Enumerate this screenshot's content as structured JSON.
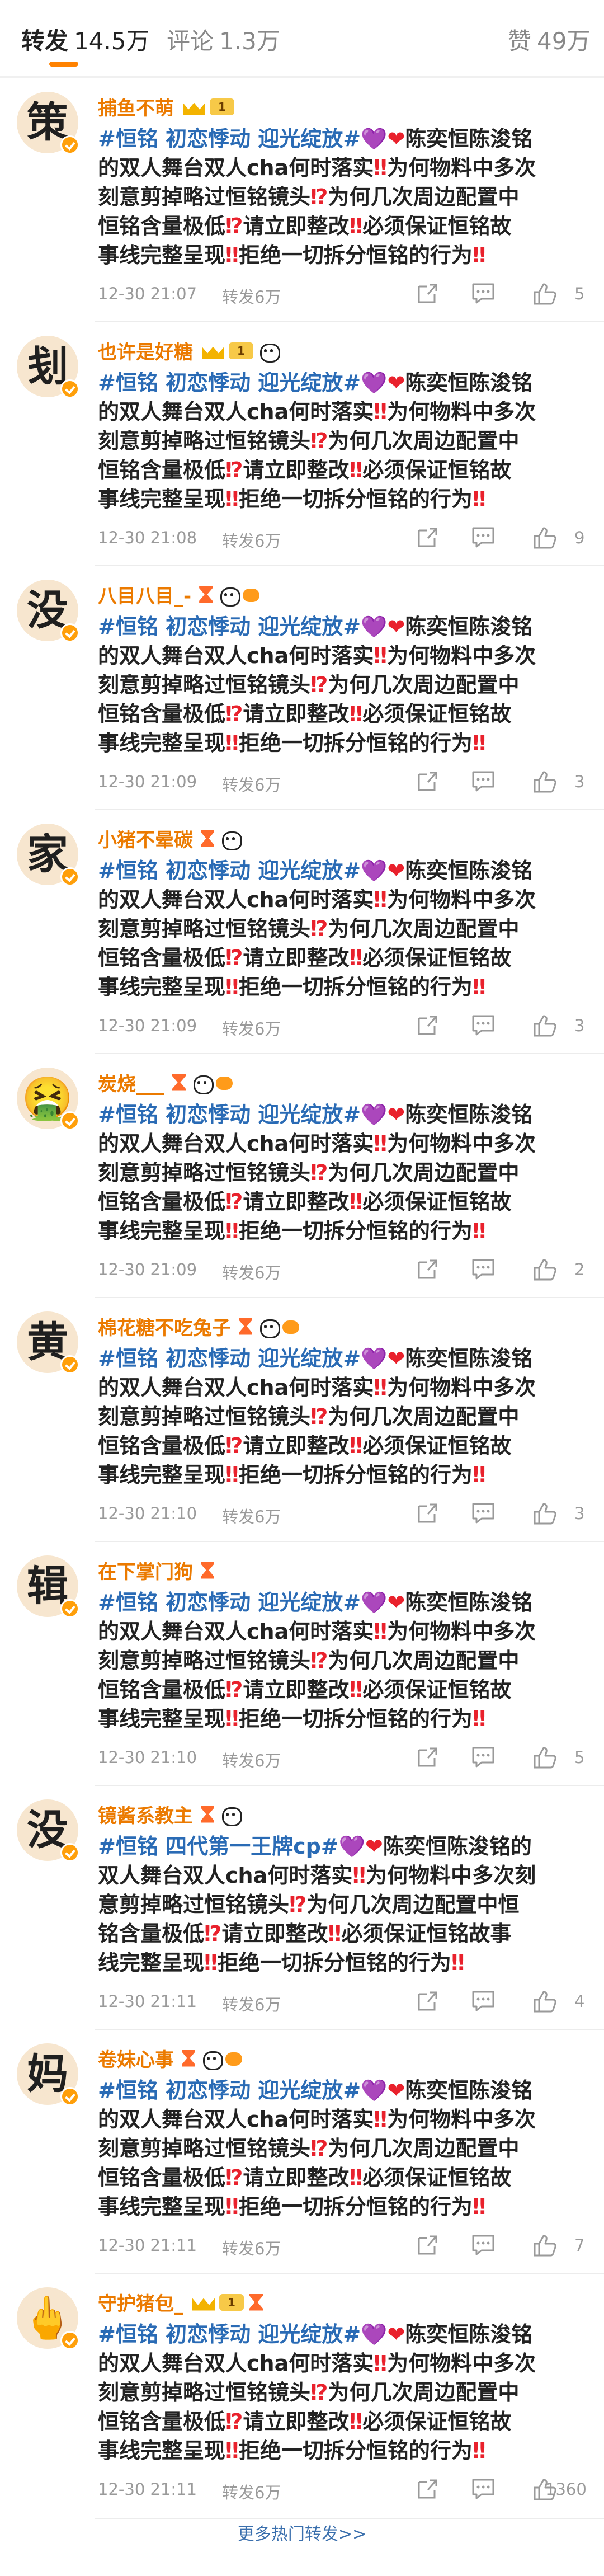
{
  "tabs": [
    {
      "label": "转发",
      "count": "14.5万",
      "active": true
    },
    {
      "label": "评论",
      "count": "1.3万",
      "active": false
    },
    {
      "label": "赞",
      "count": "49万",
      "active": false
    }
  ],
  "items": [
    {
      "name": "捕鱼不萌",
      "avatar_char": "策",
      "badges": [
        "crown",
        "level-1"
      ],
      "level": "1",
      "lines": [
        [
          {
            "t": "#恒铭 初恋悸动 迎光绽放#",
            "c": "topic"
          },
          {
            "t": "💜",
            "c": "purple"
          },
          {
            "t": "❤",
            "c": "hl"
          },
          {
            "t": "陈奕恒陈浚铭",
            "c": ""
          }
        ],
        [
          {
            "t": "的双人舞台双人cha何时落实",
            "c": ""
          },
          {
            "t": "‼",
            "c": "hl"
          },
          {
            "t": "为何物料中多次",
            "c": ""
          }
        ],
        [
          {
            "t": "刻意剪掉略过恒铭镜头",
            "c": ""
          },
          {
            "t": "⁉",
            "c": "hl"
          },
          {
            "t": "为何几次周边配置中",
            "c": ""
          }
        ],
        [
          {
            "t": "恒铭含量极低",
            "c": ""
          },
          {
            "t": "⁉",
            "c": "hl"
          },
          {
            "t": "请立即整改",
            "c": ""
          },
          {
            "t": "‼",
            "c": "hl"
          },
          {
            "t": "必须保证恒铭故",
            "c": ""
          }
        ],
        [
          {
            "t": "事线完整呈现",
            "c": ""
          },
          {
            "t": "‼",
            "c": "hl"
          },
          {
            "t": "拒绝一切拆分恒铭的行为",
            "c": ""
          },
          {
            "t": "‼",
            "c": "hl"
          }
        ]
      ],
      "time": "12-30 21:07",
      "repost": "转发6万",
      "likes": "5"
    },
    {
      "name": "也许是好糖",
      "avatar_char": "刬",
      "badges": [
        "crown",
        "level-1",
        "panda"
      ],
      "level": "1",
      "lines": [
        [
          {
            "t": "#恒铭 初恋悸动 迎光绽放#",
            "c": "topic"
          },
          {
            "t": "💜",
            "c": "purple"
          },
          {
            "t": "❤",
            "c": "hl"
          },
          {
            "t": "陈奕恒陈浚铭",
            "c": ""
          }
        ],
        [
          {
            "t": "的双人舞台双人cha何时落实",
            "c": ""
          },
          {
            "t": "‼",
            "c": "hl"
          },
          {
            "t": "为何物料中多次",
            "c": ""
          }
        ],
        [
          {
            "t": "刻意剪掉略过恒铭镜头",
            "c": ""
          },
          {
            "t": "⁉",
            "c": "hl"
          },
          {
            "t": "为何几次周边配置中",
            "c": ""
          }
        ],
        [
          {
            "t": "恒铭含量极低",
            "c": ""
          },
          {
            "t": "⁉",
            "c": "hl"
          },
          {
            "t": "请立即整改",
            "c": ""
          },
          {
            "t": "‼",
            "c": "hl"
          },
          {
            "t": "必须保证恒铭故",
            "c": ""
          }
        ],
        [
          {
            "t": "事线完整呈现",
            "c": ""
          },
          {
            "t": "‼",
            "c": "hl"
          },
          {
            "t": "拒绝一切拆分恒铭的行为",
            "c": ""
          },
          {
            "t": "‼",
            "c": "hl"
          }
        ]
      ],
      "time": "12-30 21:08",
      "repost": "转发6万",
      "likes": "9"
    },
    {
      "name": "八目八目_-",
      "avatar_char": "没",
      "badges": [
        "hourglass",
        "panda",
        "fish"
      ],
      "level": "",
      "lines": [
        [
          {
            "t": "#恒铭 初恋悸动 迎光绽放#",
            "c": "topic"
          },
          {
            "t": "💜",
            "c": "purple"
          },
          {
            "t": "❤",
            "c": "hl"
          },
          {
            "t": "陈奕恒陈浚铭",
            "c": ""
          }
        ],
        [
          {
            "t": "的双人舞台双人cha何时落实",
            "c": ""
          },
          {
            "t": "‼",
            "c": "hl"
          },
          {
            "t": "为何物料中多次",
            "c": ""
          }
        ],
        [
          {
            "t": "刻意剪掉略过恒铭镜头",
            "c": ""
          },
          {
            "t": "⁉",
            "c": "hl"
          },
          {
            "t": "为何几次周边配置中",
            "c": ""
          }
        ],
        [
          {
            "t": "恒铭含量极低",
            "c": ""
          },
          {
            "t": "⁉",
            "c": "hl"
          },
          {
            "t": "请立即整改",
            "c": ""
          },
          {
            "t": "‼",
            "c": "hl"
          },
          {
            "t": "必须保证恒铭故",
            "c": ""
          }
        ],
        [
          {
            "t": "事线完整呈现",
            "c": ""
          },
          {
            "t": "‼",
            "c": "hl"
          },
          {
            "t": "拒绝一切拆分恒铭的行为",
            "c": ""
          },
          {
            "t": "‼",
            "c": "hl"
          }
        ]
      ],
      "time": "12-30 21:09",
      "repost": "转发6万",
      "likes": "3"
    },
    {
      "name": "小猪不晕碳",
      "avatar_char": "家",
      "badges": [
        "hourglass",
        "panda"
      ],
      "level": "",
      "lines": [
        [
          {
            "t": "#恒铭 初恋悸动 迎光绽放#",
            "c": "topic"
          },
          {
            "t": "💜",
            "c": "purple"
          },
          {
            "t": "❤",
            "c": "hl"
          },
          {
            "t": "陈奕恒陈浚铭",
            "c": ""
          }
        ],
        [
          {
            "t": "的双人舞台双人cha何时落实",
            "c": ""
          },
          {
            "t": "‼",
            "c": "hl"
          },
          {
            "t": "为何物料中多次",
            "c": ""
          }
        ],
        [
          {
            "t": "刻意剪掉略过恒铭镜头",
            "c": ""
          },
          {
            "t": "⁉",
            "c": "hl"
          },
          {
            "t": "为何几次周边配置中",
            "c": ""
          }
        ],
        [
          {
            "t": "恒铭含量极低",
            "c": ""
          },
          {
            "t": "⁉",
            "c": "hl"
          },
          {
            "t": "请立即整改",
            "c": ""
          },
          {
            "t": "‼",
            "c": "hl"
          },
          {
            "t": "必须保证恒铭故",
            "c": ""
          }
        ],
        [
          {
            "t": "事线完整呈现",
            "c": ""
          },
          {
            "t": "‼",
            "c": "hl"
          },
          {
            "t": "拒绝一切拆分恒铭的行为",
            "c": ""
          },
          {
            "t": "‼",
            "c": "hl"
          }
        ]
      ],
      "time": "12-30 21:09",
      "repost": "转发6万",
      "likes": "3"
    },
    {
      "name": "炭烧___",
      "avatar_char": "🤮",
      "badges": [
        "hourglass",
        "panda",
        "fish"
      ],
      "level": "",
      "lines": [
        [
          {
            "t": "#恒铭 初恋悸动 迎光绽放#",
            "c": "topic"
          },
          {
            "t": "💜",
            "c": "purple"
          },
          {
            "t": "❤",
            "c": "hl"
          },
          {
            "t": "陈奕恒陈浚铭",
            "c": ""
          }
        ],
        [
          {
            "t": "的双人舞台双人cha何时落实",
            "c": ""
          },
          {
            "t": "‼",
            "c": "hl"
          },
          {
            "t": "为何物料中多次",
            "c": ""
          }
        ],
        [
          {
            "t": "刻意剪掉略过恒铭镜头",
            "c": ""
          },
          {
            "t": "⁉",
            "c": "hl"
          },
          {
            "t": "为何几次周边配置中",
            "c": ""
          }
        ],
        [
          {
            "t": "恒铭含量极低",
            "c": ""
          },
          {
            "t": "⁉",
            "c": "hl"
          },
          {
            "t": "请立即整改",
            "c": ""
          },
          {
            "t": "‼",
            "c": "hl"
          },
          {
            "t": "必须保证恒铭故",
            "c": ""
          }
        ],
        [
          {
            "t": "事线完整呈现",
            "c": ""
          },
          {
            "t": "‼",
            "c": "hl"
          },
          {
            "t": "拒绝一切拆分恒铭的行为",
            "c": ""
          },
          {
            "t": "‼",
            "c": "hl"
          }
        ]
      ],
      "time": "12-30 21:09",
      "repost": "转发6万",
      "likes": "2"
    },
    {
      "name": "棉花糖不吃兔子",
      "avatar_char": "黄",
      "badges": [
        "hourglass",
        "panda",
        "fish"
      ],
      "level": "",
      "lines": [
        [
          {
            "t": "#恒铭 初恋悸动 迎光绽放#",
            "c": "topic"
          },
          {
            "t": "💜",
            "c": "purple"
          },
          {
            "t": "❤",
            "c": "hl"
          },
          {
            "t": "陈奕恒陈浚铭",
            "c": ""
          }
        ],
        [
          {
            "t": "的双人舞台双人cha何时落实",
            "c": ""
          },
          {
            "t": "‼",
            "c": "hl"
          },
          {
            "t": "为何物料中多次",
            "c": ""
          }
        ],
        [
          {
            "t": "刻意剪掉略过恒铭镜头",
            "c": ""
          },
          {
            "t": "⁉",
            "c": "hl"
          },
          {
            "t": "为何几次周边配置中",
            "c": ""
          }
        ],
        [
          {
            "t": "恒铭含量极低",
            "c": ""
          },
          {
            "t": "⁉",
            "c": "hl"
          },
          {
            "t": "请立即整改",
            "c": ""
          },
          {
            "t": "‼",
            "c": "hl"
          },
          {
            "t": "必须保证恒铭故",
            "c": ""
          }
        ],
        [
          {
            "t": "事线完整呈现",
            "c": ""
          },
          {
            "t": "‼",
            "c": "hl"
          },
          {
            "t": "拒绝一切拆分恒铭的行为",
            "c": ""
          },
          {
            "t": "‼",
            "c": "hl"
          }
        ]
      ],
      "time": "12-30 21:10",
      "repost": "转发6万",
      "likes": "3"
    },
    {
      "name": "在下掌门狗",
      "avatar_char": "辑",
      "badges": [
        "hourglass"
      ],
      "level": "",
      "lines": [
        [
          {
            "t": "#恒铭 初恋悸动 迎光绽放#",
            "c": "topic"
          },
          {
            "t": "💜",
            "c": "purple"
          },
          {
            "t": "❤",
            "c": "hl"
          },
          {
            "t": "陈奕恒陈浚铭",
            "c": ""
          }
        ],
        [
          {
            "t": "的双人舞台双人cha何时落实",
            "c": ""
          },
          {
            "t": "‼",
            "c": "hl"
          },
          {
            "t": "为何物料中多次",
            "c": ""
          }
        ],
        [
          {
            "t": "刻意剪掉略过恒铭镜头",
            "c": ""
          },
          {
            "t": "⁉",
            "c": "hl"
          },
          {
            "t": "为何几次周边配置中",
            "c": ""
          }
        ],
        [
          {
            "t": "恒铭含量极低",
            "c": ""
          },
          {
            "t": "⁉",
            "c": "hl"
          },
          {
            "t": "请立即整改",
            "c": ""
          },
          {
            "t": "‼",
            "c": "hl"
          },
          {
            "t": "必须保证恒铭故",
            "c": ""
          }
        ],
        [
          {
            "t": "事线完整呈现",
            "c": ""
          },
          {
            "t": "‼",
            "c": "hl"
          },
          {
            "t": "拒绝一切拆分恒铭的行为",
            "c": ""
          },
          {
            "t": "‼",
            "c": "hl"
          }
        ]
      ],
      "time": "12-30 21:10",
      "repost": "转发6万",
      "likes": "5"
    },
    {
      "name": "镜酱系教主",
      "avatar_char": "没",
      "badges": [
        "hourglass",
        "panda"
      ],
      "level": "",
      "lines": [
        [
          {
            "t": "#恒铭 四代第一王牌cp#",
            "c": "topic"
          },
          {
            "t": "💜",
            "c": "purple"
          },
          {
            "t": "❤",
            "c": "hl"
          },
          {
            "t": "陈奕恒陈浚铭的",
            "c": ""
          }
        ],
        [
          {
            "t": "双人舞台双人cha何时落实",
            "c": ""
          },
          {
            "t": "‼",
            "c": "hl"
          },
          {
            "t": "为何物料中多次刻",
            "c": ""
          }
        ],
        [
          {
            "t": "意剪掉略过恒铭镜头",
            "c": ""
          },
          {
            "t": "⁉",
            "c": "hl"
          },
          {
            "t": "为何几次周边配置中恒",
            "c": ""
          }
        ],
        [
          {
            "t": "铭含量极低",
            "c": ""
          },
          {
            "t": "⁉",
            "c": "hl"
          },
          {
            "t": "请立即整改",
            "c": ""
          },
          {
            "t": "‼",
            "c": "hl"
          },
          {
            "t": "必须保证恒铭故事",
            "c": ""
          }
        ],
        [
          {
            "t": "线完整呈现",
            "c": ""
          },
          {
            "t": "‼",
            "c": "hl"
          },
          {
            "t": "拒绝一切拆分恒铭的行为",
            "c": ""
          },
          {
            "t": "‼",
            "c": "hl"
          }
        ]
      ],
      "time": "12-30 21:11",
      "repost": "转发6万",
      "likes": "4"
    },
    {
      "name": "卷妹心事",
      "avatar_char": "妈",
      "badges": [
        "hourglass",
        "panda",
        "fish"
      ],
      "level": "",
      "lines": [
        [
          {
            "t": "#恒铭 初恋悸动 迎光绽放#",
            "c": "topic"
          },
          {
            "t": "💜",
            "c": "purple"
          },
          {
            "t": "❤",
            "c": "hl"
          },
          {
            "t": "陈奕恒陈浚铭",
            "c": ""
          }
        ],
        [
          {
            "t": "的双人舞台双人cha何时落实",
            "c": ""
          },
          {
            "t": "‼",
            "c": "hl"
          },
          {
            "t": "为何物料中多次",
            "c": ""
          }
        ],
        [
          {
            "t": "刻意剪掉略过恒铭镜头",
            "c": ""
          },
          {
            "t": "⁉",
            "c": "hl"
          },
          {
            "t": "为何几次周边配置中",
            "c": ""
          }
        ],
        [
          {
            "t": "恒铭含量极低",
            "c": ""
          },
          {
            "t": "⁉",
            "c": "hl"
          },
          {
            "t": "请立即整改",
            "c": ""
          },
          {
            "t": "‼",
            "c": "hl"
          },
          {
            "t": "必须保证恒铭故",
            "c": ""
          }
        ],
        [
          {
            "t": "事线完整呈现",
            "c": ""
          },
          {
            "t": "‼",
            "c": "hl"
          },
          {
            "t": "拒绝一切拆分恒铭的行为",
            "c": ""
          },
          {
            "t": "‼",
            "c": "hl"
          }
        ]
      ],
      "time": "12-30 21:11",
      "repost": "转发6万",
      "likes": "7"
    },
    {
      "name": "守护猪包_",
      "avatar_char": "🖕",
      "badges": [
        "crown",
        "level-1",
        "hourglass"
      ],
      "level": "1",
      "lines": [
        [
          {
            "t": "#恒铭 初恋悸动 迎光绽放#",
            "c": "topic"
          },
          {
            "t": "💜",
            "c": "purple"
          },
          {
            "t": "❤",
            "c": "hl"
          },
          {
            "t": "陈奕恒陈浚铭",
            "c": ""
          }
        ],
        [
          {
            "t": "的双人舞台双人cha何时落实",
            "c": ""
          },
          {
            "t": "‼",
            "c": "hl"
          },
          {
            "t": "为何物料中多次",
            "c": ""
          }
        ],
        [
          {
            "t": "刻意剪掉略过恒铭镜头",
            "c": ""
          },
          {
            "t": "⁉",
            "c": "hl"
          },
          {
            "t": "为何几次周边配置中",
            "c": ""
          }
        ],
        [
          {
            "t": "恒铭含量极低",
            "c": ""
          },
          {
            "t": "⁉",
            "c": "hl"
          },
          {
            "t": "请立即整改",
            "c": ""
          },
          {
            "t": "‼",
            "c": "hl"
          },
          {
            "t": "必须保证恒铭故",
            "c": ""
          }
        ],
        [
          {
            "t": "事线完整呈现",
            "c": ""
          },
          {
            "t": "‼",
            "c": "hl"
          },
          {
            "t": "拒绝一切拆分恒铭的行为",
            "c": ""
          },
          {
            "t": "‼",
            "c": "hl"
          }
        ]
      ],
      "time": "12-30 21:11",
      "repost": "转发6万",
      "likes": "1360"
    }
  ],
  "more_label": "更多热门转发>>",
  "colors": {
    "accent": "#ff8200",
    "username": "#eb7a00",
    "topic": "#2a6bb5",
    "emphasis": "#e9212c",
    "meta": "#9a9a9a"
  },
  "icons": {
    "share": "share-icon",
    "comment": "comment-icon",
    "like": "like-icon",
    "verified": "verified-badge-icon"
  }
}
